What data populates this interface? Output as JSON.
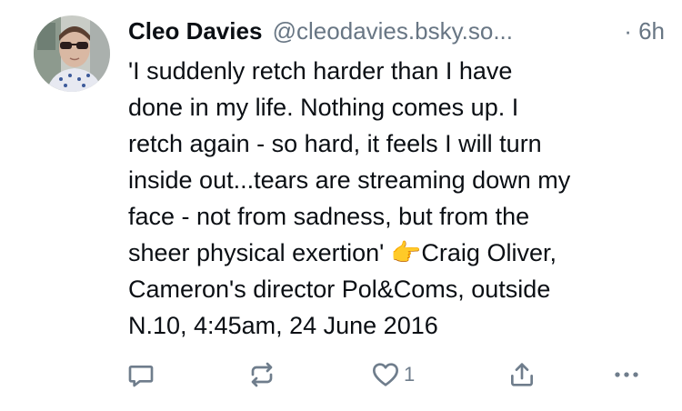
{
  "post": {
    "author": {
      "display_name": "Cleo Davies",
      "handle": "@cleodavies.bsky.so...",
      "avatar_icon": "avatar-photo"
    },
    "time": "· 6h",
    "text": "'I suddenly retch harder than I have\ndone in my life. Nothing comes up. I\nretch again - so hard, it feels I will turn\ninside out...tears are streaming down my\nface - not from sadness, but from the\nsheer physical exertion' 👉Craig Oliver,\nCameron's director Pol&Coms, outside\nN.10, 4:45am, 24 June 2016",
    "actions": {
      "reply_icon": "reply-icon",
      "repost_icon": "repost-icon",
      "like_icon": "heart-icon",
      "like_count": "1",
      "share_icon": "share-icon",
      "more_icon": "more-icon"
    }
  },
  "colors": {
    "text_primary": "#0b0f14",
    "text_secondary": "#687684",
    "icon": "#6f7d8c",
    "background": "#ffffff"
  }
}
